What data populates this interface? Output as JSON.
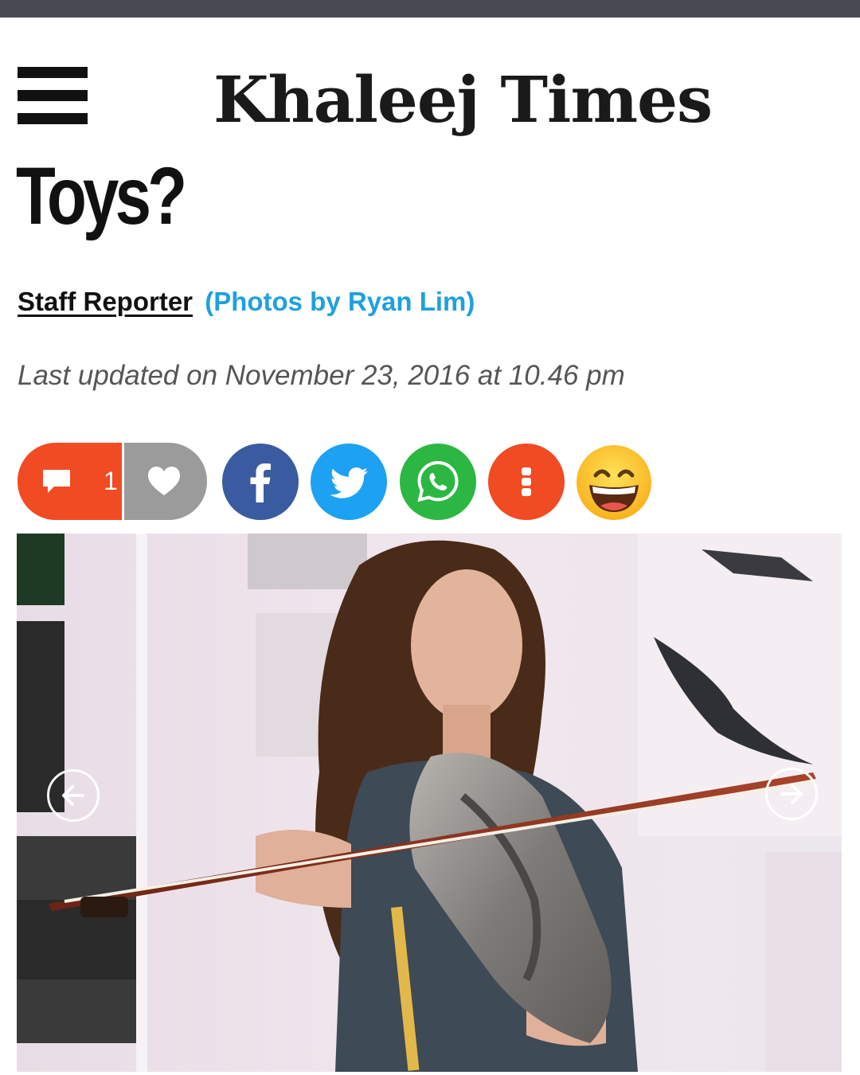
{
  "header": {
    "logo_text": "Khaleej Times"
  },
  "article": {
    "headline": "Toys?",
    "author": "Staff Reporter",
    "photo_credit": "(Photos by Ryan Lim)",
    "last_updated": "Last updated on November 23, 2016 at 10.46 pm"
  },
  "engagement": {
    "comment_count": "1"
  },
  "icons": {
    "menu": "hamburger-menu-icon",
    "comment": "comment-bubble-icon",
    "like": "heart-icon",
    "facebook": "facebook-icon",
    "twitter": "twitter-icon",
    "whatsapp": "whatsapp-icon",
    "more": "more-vertical-icon",
    "reaction": "grinning-emoji-icon",
    "prev": "arrow-left-icon",
    "next": "arrow-right-icon"
  },
  "colors": {
    "comment": "#f04b23",
    "like": "#9b9b9b",
    "facebook": "#3a5ba0",
    "twitter": "#1da1f2",
    "whatsapp": "#2cb742",
    "more": "#f04b23",
    "photo_credit": "#1ea1dc"
  }
}
